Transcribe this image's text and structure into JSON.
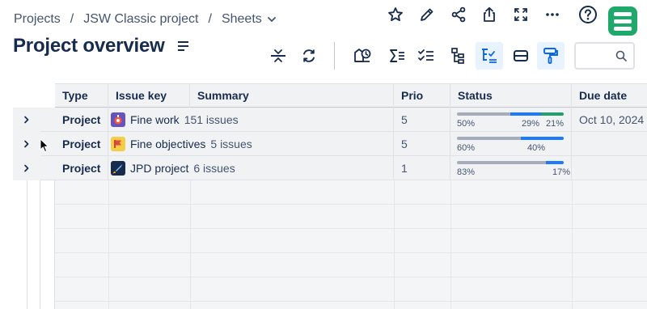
{
  "breadcrumb": {
    "items": [
      "Projects",
      "JSW Classic project",
      "Sheets"
    ],
    "separator": "/"
  },
  "page_title": "Project overview",
  "search": {
    "value": "",
    "placeholder": ""
  },
  "columns": [
    "Type",
    "Issue key",
    "Summary",
    "Prio",
    "Status",
    "Due date"
  ],
  "rows": [
    {
      "type": "Project",
      "key": "Fine work",
      "count": "151 issues",
      "prio": "5",
      "icon_color": "#6554c0",
      "due": "Oct 10, 2024",
      "status": [
        {
          "label": "50%",
          "pct": 50,
          "color": "#a5adba"
        },
        {
          "label": "29%",
          "pct": 29,
          "color": "#1d7afc"
        },
        {
          "label": "21%",
          "pct": 21,
          "color": "#22a06b"
        }
      ]
    },
    {
      "type": "Project",
      "key": "Fine objectives",
      "count": "5 issues",
      "prio": "5",
      "icon_color": "#f5cd47",
      "due": "",
      "status": [
        {
          "label": "60%",
          "pct": 60,
          "color": "#a5adba"
        },
        {
          "label": "40%",
          "pct": 40,
          "color": "#1d7afc"
        }
      ]
    },
    {
      "type": "Project",
      "key": "JPD project",
      "count": "6 issues",
      "prio": "1",
      "icon_color": "#172b4d",
      "due": "",
      "status": [
        {
          "label": "83%",
          "pct": 83,
          "color": "#a5adba"
        },
        {
          "label": "17%",
          "pct": 17,
          "color": "#1d7afc"
        }
      ]
    }
  ],
  "colors": {
    "brand": "#1fa86b",
    "accent": "#0c66e4",
    "active_tool_bg": "#e9f2ff"
  },
  "icons": {
    "top_actions": [
      "star-icon",
      "pencil-icon",
      "share-icon",
      "export-icon",
      "fullscreen-icon",
      "more-icon",
      "help-icon"
    ],
    "toolbar": [
      "collapse-rows-icon",
      "refresh-icon",
      "automation-icon",
      "sum-icon",
      "checklist-icon",
      "hierarchy-icon",
      "tree-filter-icon",
      "row-height-icon",
      "paint-roller-icon",
      "search-icon"
    ]
  }
}
